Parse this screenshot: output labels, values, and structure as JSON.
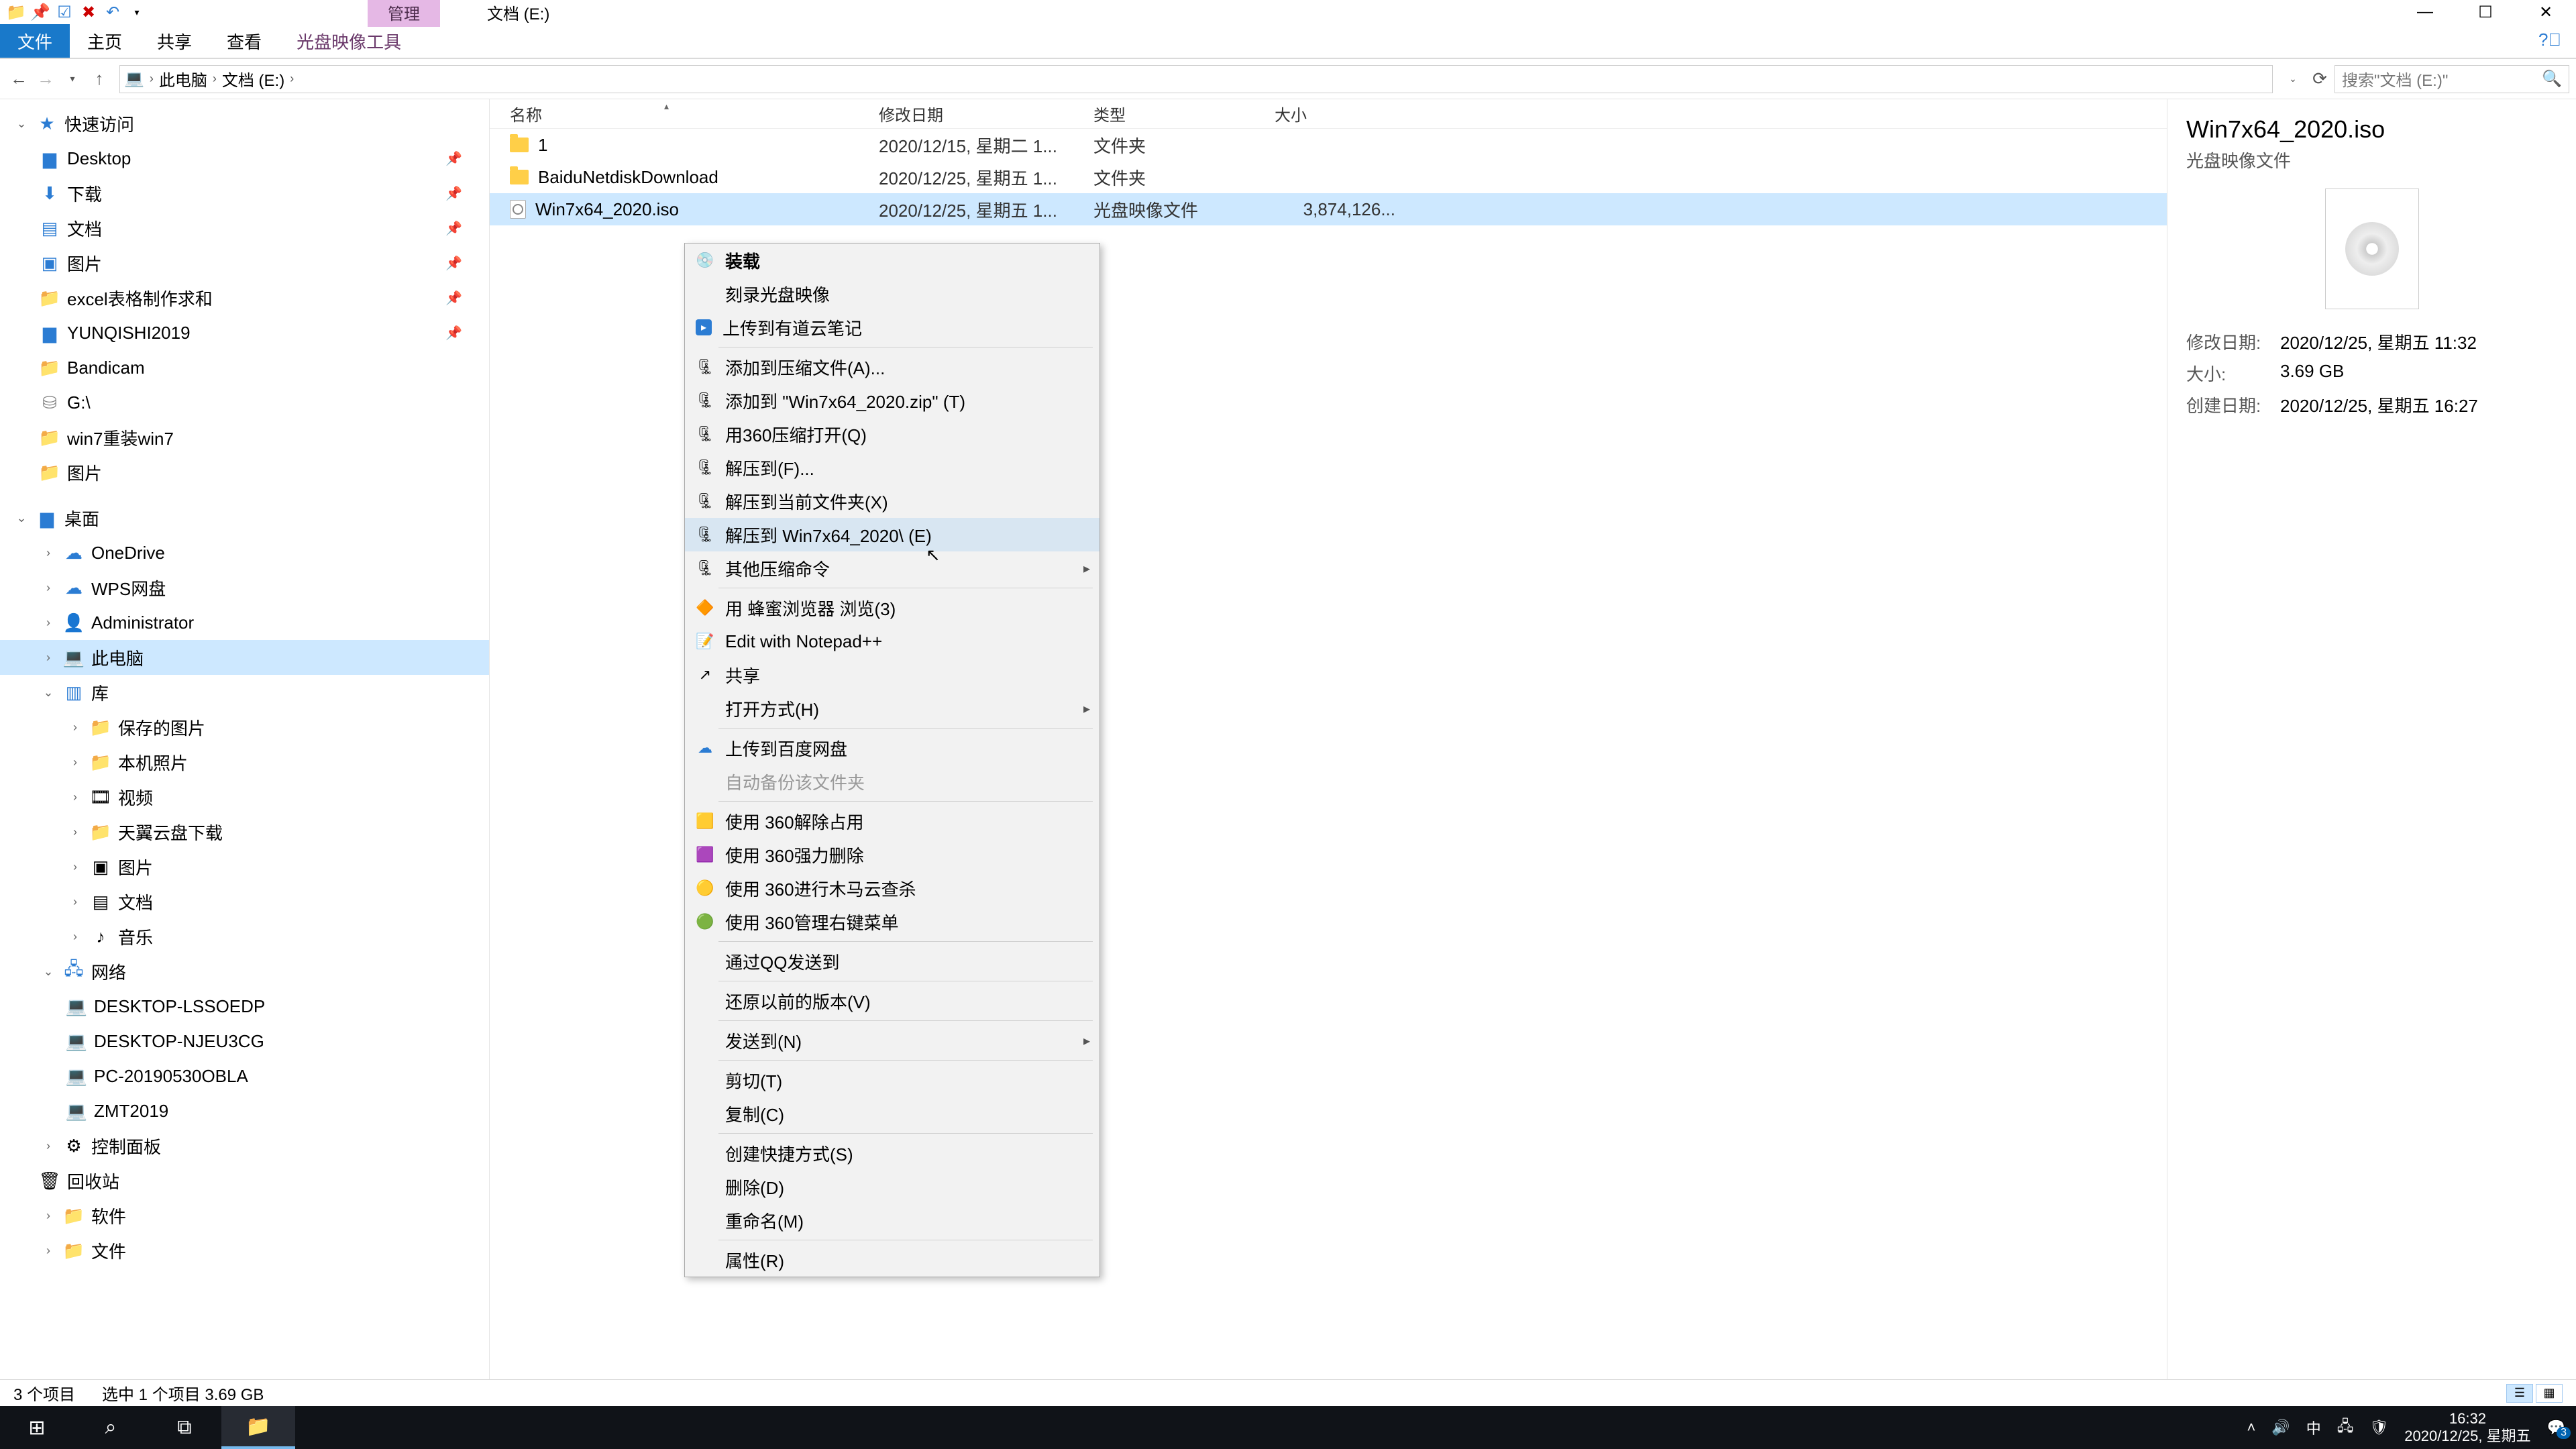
{
  "window": {
    "manage_tab": "管理",
    "title": "文档 (E:)"
  },
  "ribbon": {
    "file": "文件",
    "home": "主页",
    "share": "共享",
    "view": "查看",
    "disc_tools": "光盘映像工具"
  },
  "breadcrumb": {
    "root": "此电脑",
    "loc": "文档 (E:)"
  },
  "search": {
    "placeholder": "搜索\"文档 (E:)\""
  },
  "tree": {
    "quick": "快速访问",
    "desktop": "Desktop",
    "downloads": "下载",
    "documents": "文档",
    "pictures": "图片",
    "excel": "excel表格制作求和",
    "yunqishi": "YUNQISHI2019",
    "bandicam": "Bandicam",
    "gdrive": "G:\\",
    "win7re": "win7重装win7",
    "pictures2": "图片",
    "desktop_zh": "桌面",
    "onedrive": "OneDrive",
    "wps": "WPS网盘",
    "admin": "Administrator",
    "thispc": "此电脑",
    "libraries": "库",
    "savedpics": "保存的图片",
    "camera": "本机照片",
    "videos": "视频",
    "tianyi": "天翼云盘下载",
    "pics3": "图片",
    "docs2": "文档",
    "music": "音乐",
    "network": "网络",
    "pc1": "DESKTOP-LSSOEDP",
    "pc2": "DESKTOP-NJEU3CG",
    "pc3": "PC-20190530OBLA",
    "pc4": "ZMT2019",
    "cp": "控制面板",
    "recycle": "回收站",
    "soft": "软件",
    "files": "文件"
  },
  "cols": {
    "name": "名称",
    "date": "修改日期",
    "type": "类型",
    "size": "大小"
  },
  "rows": [
    {
      "name": "1",
      "date": "2020/12/15, 星期二 1...",
      "type": "文件夹",
      "size": ""
    },
    {
      "name": "BaiduNetdiskDownload",
      "date": "2020/12/25, 星期五 1...",
      "type": "文件夹",
      "size": ""
    },
    {
      "name": "Win7x64_2020.iso",
      "date": "2020/12/25, 星期五 1...",
      "type": "光盘映像文件",
      "size": "3,874,126..."
    }
  ],
  "ctx": {
    "mount": "装载",
    "burn": "刻录光盘映像",
    "youdao": "上传到有道云笔记",
    "addarchive": "添加到压缩文件(A)...",
    "addzip": "添加到 \"Win7x64_2020.zip\" (T)",
    "open360": "用360压缩打开(Q)",
    "extractto": "解压到(F)...",
    "extracthere": "解压到当前文件夹(X)",
    "extractfolder": "解压到 Win7x64_2020\\ (E)",
    "othercomp": "其他压缩命令",
    "bee": "用 蜂蜜浏览器 浏览(3)",
    "npp": "Edit with Notepad++",
    "share": "共享",
    "openwith": "打开方式(H)",
    "baidu": "上传到百度网盘",
    "autobackup": "自动备份该文件夹",
    "unlock360": "使用 360解除占用",
    "forcedel": "使用 360强力删除",
    "trojan": "使用 360进行木马云查杀",
    "manage360": "使用 360管理右键菜单",
    "qq": "通过QQ发送到",
    "restore": "还原以前的版本(V)",
    "sendto": "发送到(N)",
    "cut": "剪切(T)",
    "copy": "复制(C)",
    "shortcut": "创建快捷方式(S)",
    "delete": "删除(D)",
    "rename": "重命名(M)",
    "props": "属性(R)"
  },
  "details": {
    "title": "Win7x64_2020.iso",
    "subtitle": "光盘映像文件",
    "mdate_k": "修改日期:",
    "mdate_v": "2020/12/25, 星期五 11:32",
    "size_k": "大小:",
    "size_v": "3.69 GB",
    "cdate_k": "创建日期:",
    "cdate_v": "2020/12/25, 星期五 16:27"
  },
  "status": {
    "count": "3 个项目",
    "selected": "选中 1 个项目  3.69 GB"
  },
  "taskbar": {
    "ime": "中",
    "time": "16:32",
    "date": "2020/12/25, 星期五"
  }
}
